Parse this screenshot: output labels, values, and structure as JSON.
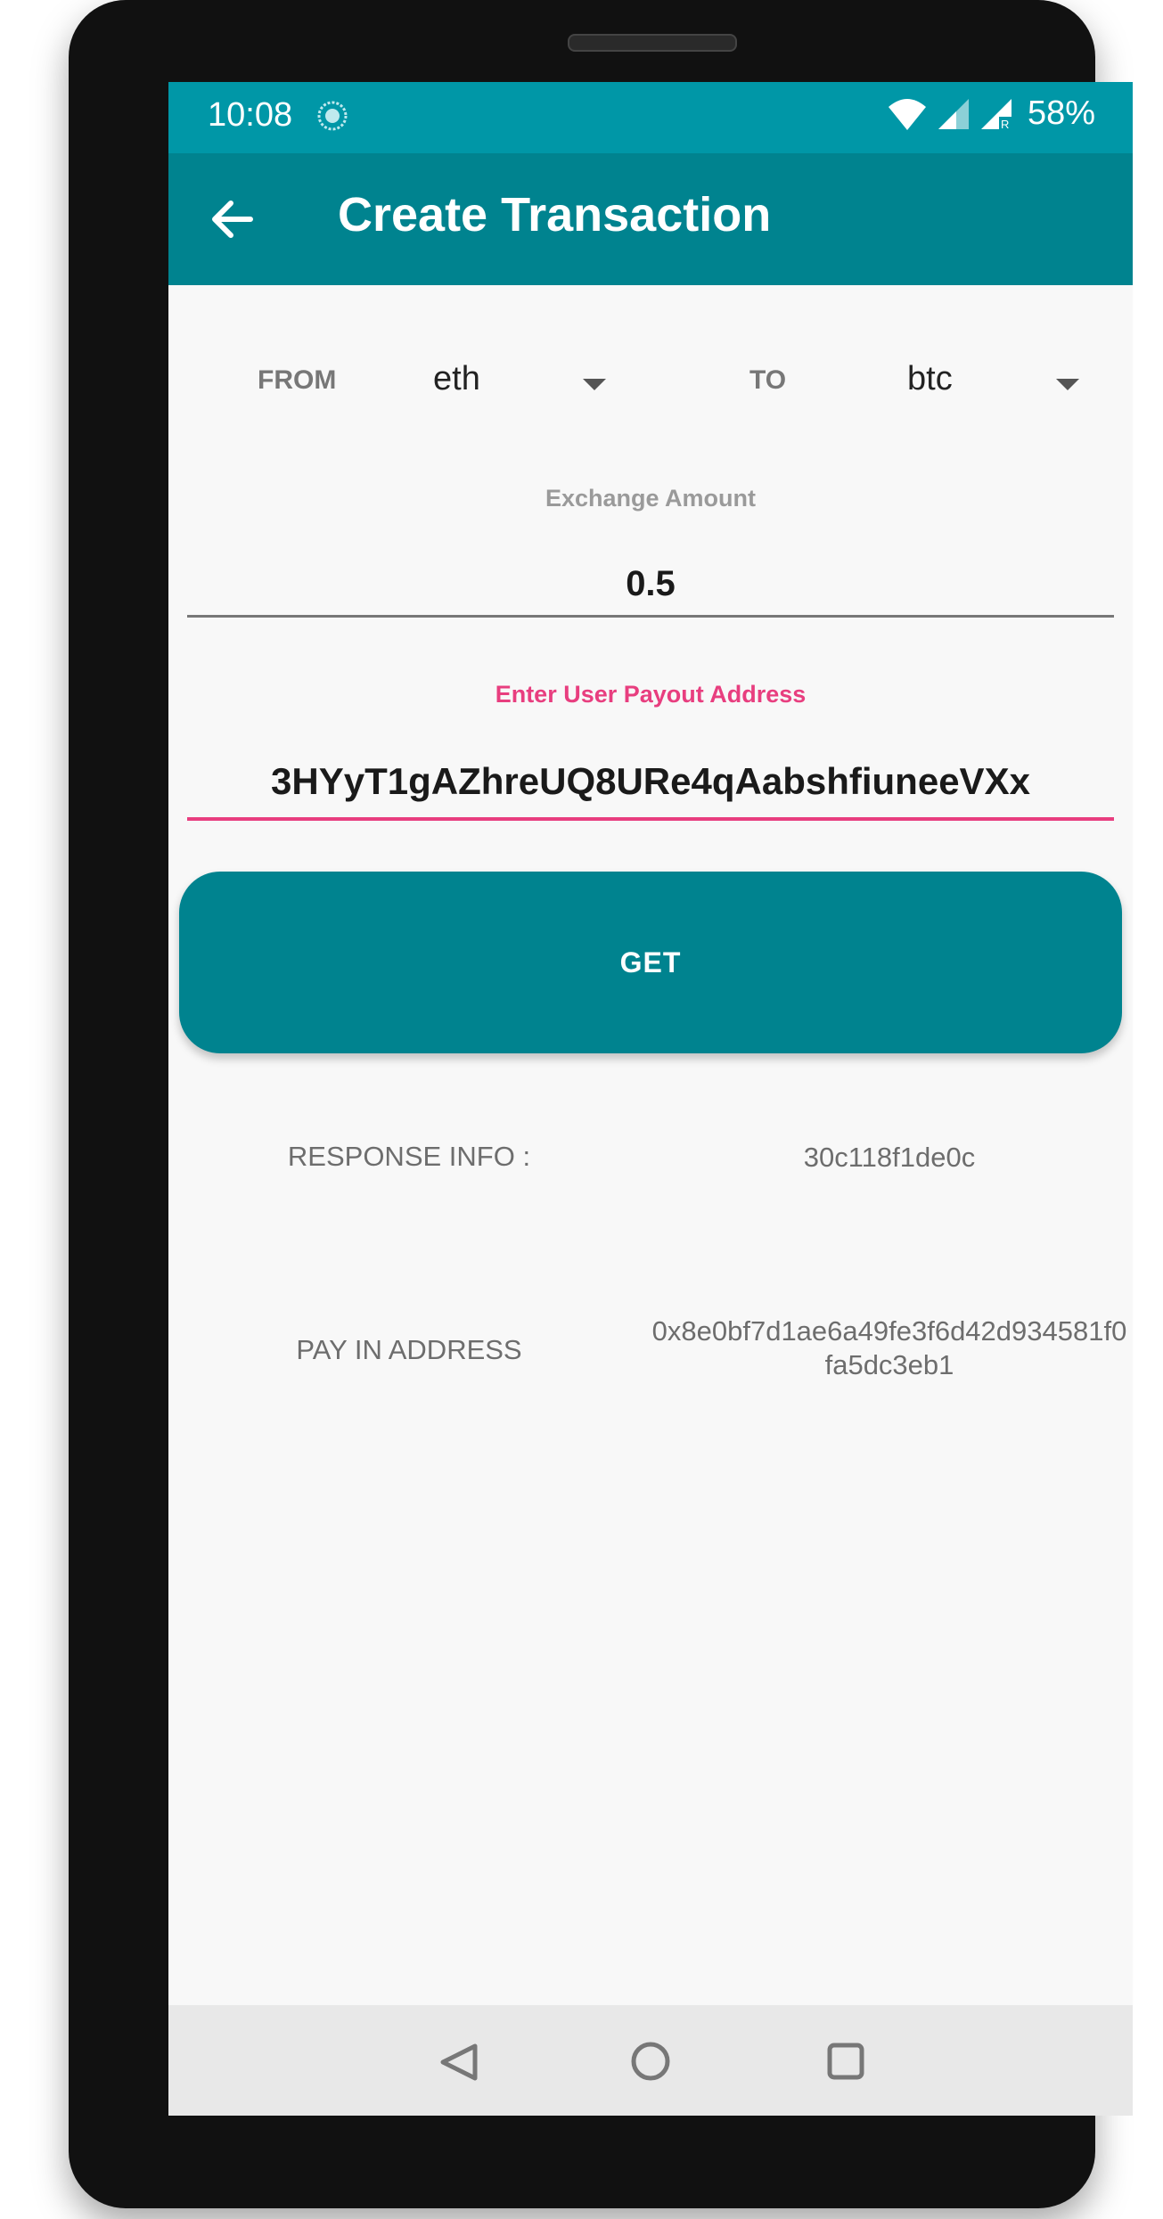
{
  "status_bar": {
    "time": "10:08",
    "battery": "58%",
    "icons": [
      "sync-icon",
      "wifi-icon",
      "cell-signal-icon",
      "cell-signal-roaming-icon"
    ]
  },
  "app_bar": {
    "title": "Create Transaction",
    "back_icon": "arrow-left-icon"
  },
  "form": {
    "from_label": "FROM",
    "from_value": "eth",
    "to_label": "TO",
    "to_value": "btc",
    "amount_label": "Exchange Amount",
    "amount_value": "0.5",
    "payout_label": "Enter User Payout Address",
    "payout_value": "3HYyT1gAZhreUQ8URe4qAabshfiuneeVXx",
    "submit_label": "GET"
  },
  "response": {
    "info_label": "RESPONSE INFO :",
    "info_value": "30c118f1de0c",
    "pay_in_label": "PAY IN ADDRESS",
    "pay_in_value": "0x8e0bf7d1ae6a49fe3f6d42d934581f0fa5dc3eb1"
  },
  "colors": {
    "status_bar": "#0097a7",
    "primary": "#00838f",
    "accent": "#e83e7f",
    "background": "#f8f8f8"
  },
  "nav_bar": {
    "icons": [
      "nav-back-icon",
      "nav-home-icon",
      "nav-recents-icon"
    ]
  }
}
